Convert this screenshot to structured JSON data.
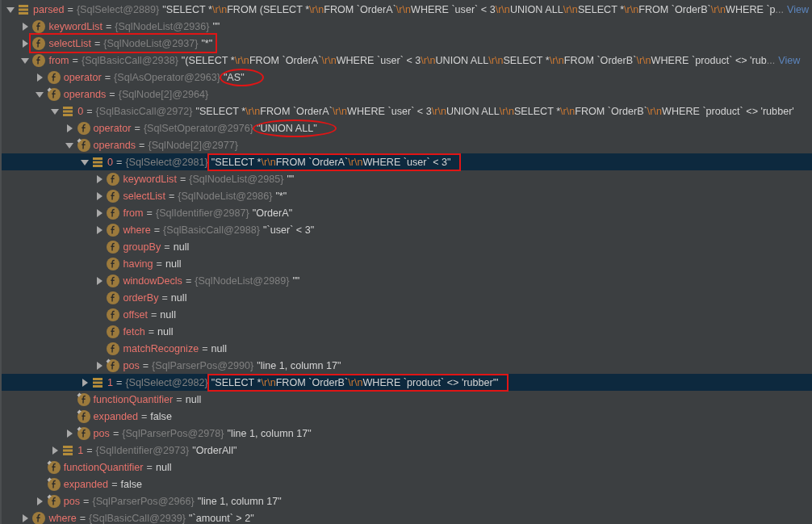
{
  "separator": "=",
  "tree": [
    {
      "name": "parsed",
      "kind": "list",
      "expanded": true,
      "selected": false,
      "type": "{SqlSelect@2889}",
      "value": "\"SELECT *\\r\\nFROM (SELECT *\\r\\nFROM `OrderA`\\r\\nWHERE `user` < 3\\r\\nUNION ALL\\r\\nSELECT *\\r\\nFROM `OrderB`\\r\\nWHERE `p",
      "ellipsis": "...",
      "link": "View",
      "children": [
        {
          "name": "keywordList",
          "kind": "field",
          "final": false,
          "expanded": false,
          "selected": false,
          "type": "{SqlNodeList@2936}",
          "value": "\"\""
        },
        {
          "name": "selectList",
          "kind": "field",
          "final": false,
          "expanded": false,
          "selected": false,
          "type": "{SqlNodeList@2937}",
          "value": "\"*\"",
          "annotation": {
            "kind": "row_box"
          }
        },
        {
          "name": "from",
          "kind": "field",
          "final": false,
          "expanded": true,
          "selected": false,
          "type": "{SqlBasicCall@2938}",
          "value": "\"(SELECT *\\r\\nFROM `OrderA`\\r\\nWHERE `user` < 3\\r\\nUNION ALL\\r\\nSELECT *\\r\\nFROM `OrderB`\\r\\nWHERE `product` <> 'rub",
          "ellipsis": "...",
          "link": "View",
          "children": [
            {
              "name": "operator",
              "kind": "field",
              "final": false,
              "expanded": false,
              "selected": false,
              "type": "{SqlAsOperator@2963}",
              "value": "\"AS\"",
              "annotation": {
                "kind": "value_ellipse"
              }
            },
            {
              "name": "operands",
              "kind": "field",
              "final": true,
              "expanded": true,
              "selected": false,
              "type": "{SqlNode[2]@2964}",
              "children": [
                {
                  "name": "0",
                  "kind": "list",
                  "expanded": true,
                  "selected": false,
                  "type": "{SqlBasicCall@2972}",
                  "value": "\"SELECT *\\r\\nFROM `OrderA`\\r\\nWHERE `user` < 3\\r\\nUNION ALL\\r\\nSELECT *\\r\\nFROM `OrderB`\\r\\nWHERE `product` <> 'rubber'",
                  "children": [
                    {
                      "name": "operator",
                      "kind": "field",
                      "final": false,
                      "expanded": false,
                      "selected": false,
                      "type": "{SqlSetOperator@2976}",
                      "value": "\"UNION ALL\"",
                      "annotation": {
                        "kind": "value_ellipse"
                      }
                    },
                    {
                      "name": "operands",
                      "kind": "field",
                      "final": true,
                      "expanded": true,
                      "selected": false,
                      "type": "{SqlNode[2]@2977}",
                      "children": [
                        {
                          "name": "0",
                          "kind": "list",
                          "expanded": true,
                          "selected": true,
                          "type": "{SqlSelect@2981}",
                          "value": "\"SELECT *\\r\\nFROM `OrderA`\\r\\nWHERE `user` < 3\"",
                          "annotation": {
                            "kind": "value_box"
                          },
                          "children": [
                            {
                              "name": "keywordList",
                              "kind": "field",
                              "final": false,
                              "expanded": false,
                              "selected": false,
                              "type": "{SqlNodeList@2985}",
                              "value": "\"\""
                            },
                            {
                              "name": "selectList",
                              "kind": "field",
                              "final": false,
                              "expanded": false,
                              "selected": false,
                              "type": "{SqlNodeList@2986}",
                              "value": "\"*\""
                            },
                            {
                              "name": "from",
                              "kind": "field",
                              "final": false,
                              "expanded": false,
                              "selected": false,
                              "type": "{SqlIdentifier@2987}",
                              "value": "\"OrderA\""
                            },
                            {
                              "name": "where",
                              "kind": "field",
                              "final": false,
                              "expanded": false,
                              "selected": false,
                              "type": "{SqlBasicCall@2988}",
                              "value": "\"`user` < 3\""
                            },
                            {
                              "name": "groupBy",
                              "kind": "field",
                              "final": false,
                              "selected": false,
                              "value": "null"
                            },
                            {
                              "name": "having",
                              "kind": "field",
                              "final": false,
                              "selected": false,
                              "value": "null"
                            },
                            {
                              "name": "windowDecls",
                              "kind": "field",
                              "final": false,
                              "expanded": false,
                              "selected": false,
                              "type": "{SqlNodeList@2989}",
                              "value": "\"\""
                            },
                            {
                              "name": "orderBy",
                              "kind": "field",
                              "final": false,
                              "selected": false,
                              "value": "null"
                            },
                            {
                              "name": "offset",
                              "kind": "field",
                              "final": false,
                              "selected": false,
                              "value": "null"
                            },
                            {
                              "name": "fetch",
                              "kind": "field",
                              "final": false,
                              "selected": false,
                              "value": "null"
                            },
                            {
                              "name": "matchRecognize",
                              "kind": "field",
                              "final": false,
                              "selected": false,
                              "value": "null"
                            },
                            {
                              "name": "pos",
                              "kind": "field",
                              "final": true,
                              "expanded": false,
                              "selected": false,
                              "type": "{SqlParserPos@2990}",
                              "value": "\"line 1, column 17\""
                            }
                          ]
                        },
                        {
                          "name": "1",
                          "kind": "list",
                          "expanded": false,
                          "selected": true,
                          "type": "{SqlSelect@2982}",
                          "value": "\"SELECT *\\r\\nFROM `OrderB`\\r\\nWHERE `product` <> 'rubber'\"",
                          "annotation": {
                            "kind": "value_box"
                          }
                        }
                      ]
                    },
                    {
                      "name": "functionQuantifier",
                      "kind": "field",
                      "final": true,
                      "selected": false,
                      "value": "null"
                    },
                    {
                      "name": "expanded",
                      "kind": "field",
                      "final": true,
                      "selected": false,
                      "value": "false"
                    },
                    {
                      "name": "pos",
                      "kind": "field",
                      "final": true,
                      "expanded": false,
                      "selected": false,
                      "type": "{SqlParserPos@2978}",
                      "value": "\"line 1, column 17\""
                    }
                  ]
                },
                {
                  "name": "1",
                  "kind": "list",
                  "expanded": false,
                  "selected": false,
                  "type": "{SqlIdentifier@2973}",
                  "value": "\"OrderAll\""
                }
              ]
            },
            {
              "name": "functionQuantifier",
              "kind": "field",
              "final": true,
              "selected": false,
              "value": "null"
            },
            {
              "name": "expanded",
              "kind": "field",
              "final": true,
              "selected": false,
              "value": "false"
            },
            {
              "name": "pos",
              "kind": "field",
              "final": true,
              "expanded": false,
              "selected": false,
              "type": "{SqlParserPos@2966}",
              "value": "\"line 1, column 17\""
            }
          ]
        },
        {
          "name": "where",
          "kind": "field",
          "final": false,
          "expanded": false,
          "selected": false,
          "type": "{SqlBasicCall@2939}",
          "value": "\"`amount` > 2\""
        }
      ]
    }
  ]
}
